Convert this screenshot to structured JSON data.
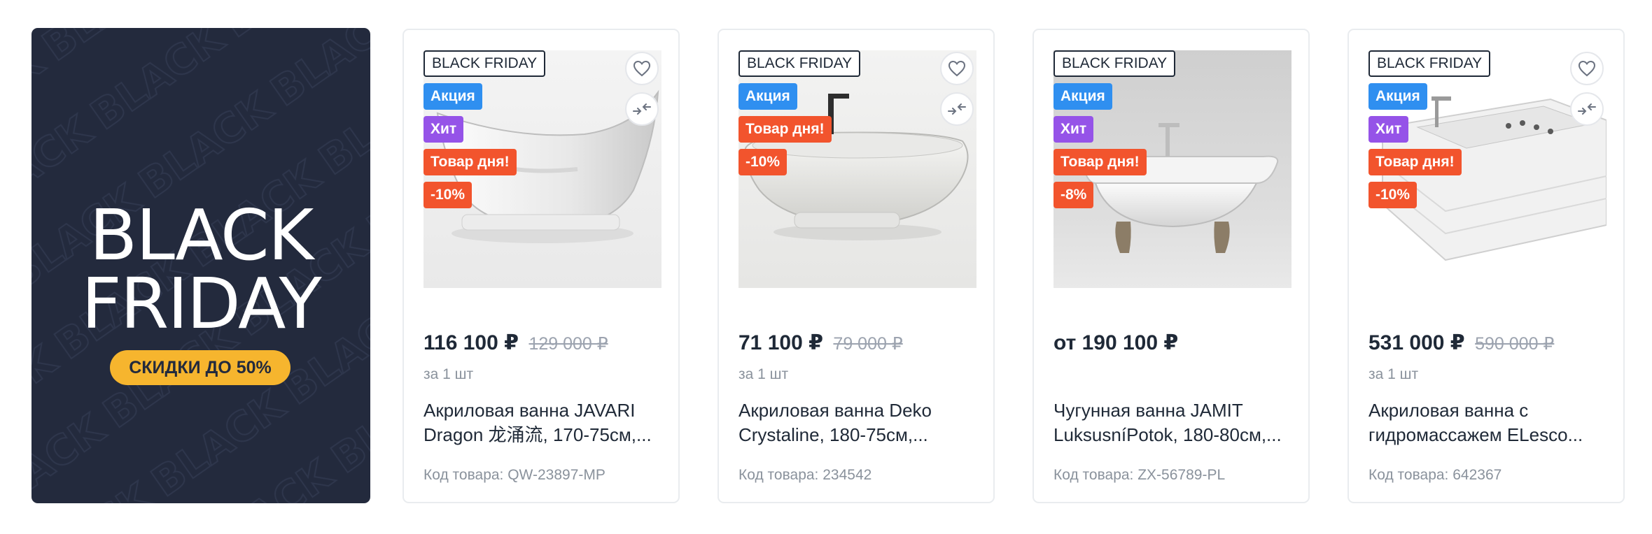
{
  "promo": {
    "title_line1": "BLACK",
    "title_line2": "FRIDAY",
    "pill": "СКИДКИ ДО 50%",
    "watermark": "BLACK",
    "colors": {
      "background": "#232a3d",
      "pill": "#f6b52e"
    }
  },
  "colors": {
    "badge_sale": "#2f8ff0",
    "badge_hit": "#9553e8",
    "badge_day": "#f2542d"
  },
  "products": [
    {
      "badge_bf": "BLACK FRIDAY",
      "badge_sale": "Акция",
      "badge_hit": "Хит",
      "badge_day": "Товар дня!",
      "badge_discount": "-10%",
      "price": "116 100 ₽",
      "old_price": "129 000 ₽",
      "unit": "за 1 шт",
      "name": "Акриловая ванна JAVARI Dragon 龙涌流, 170-75см,...",
      "sku": "Код товара: QW-23897-MP",
      "image": "bathtub-javari-icon"
    },
    {
      "badge_bf": "BLACK FRIDAY",
      "badge_sale": "Акция",
      "badge_day": "Товар дня!",
      "badge_discount": "-10%",
      "price": "71 100 ₽",
      "old_price": "79 000 ₽",
      "unit": "за 1 шт",
      "name": "Акриловая ванна Deko Crystaline, 180-75см,...",
      "sku": "Код товара: 234542",
      "image": "bathtub-deko-icon"
    },
    {
      "badge_bf": "BLACK FRIDAY",
      "badge_sale": "Акция",
      "badge_hit": "Хит",
      "badge_day": "Товар дня!",
      "badge_discount": "-8%",
      "price": "от 190 100 ₽",
      "name": "Чугунная ванна JAMIT LuksusníPotok, 180-80см,...",
      "sku": "Код товара: ZX-56789-PL",
      "image": "bathtub-jamit-icon"
    },
    {
      "badge_bf": "BLACK FRIDAY",
      "badge_sale": "Акция",
      "badge_hit": "Хит",
      "badge_day": "Товар дня!",
      "badge_discount": "-10%",
      "price": "531 000 ₽",
      "old_price": "590 000 ₽",
      "unit": "за 1 шт",
      "name": "Акриловая ванна с гидромассажем ELesco...",
      "sku": "Код товара: 642367",
      "image": "bathtub-elesco-icon"
    }
  ]
}
